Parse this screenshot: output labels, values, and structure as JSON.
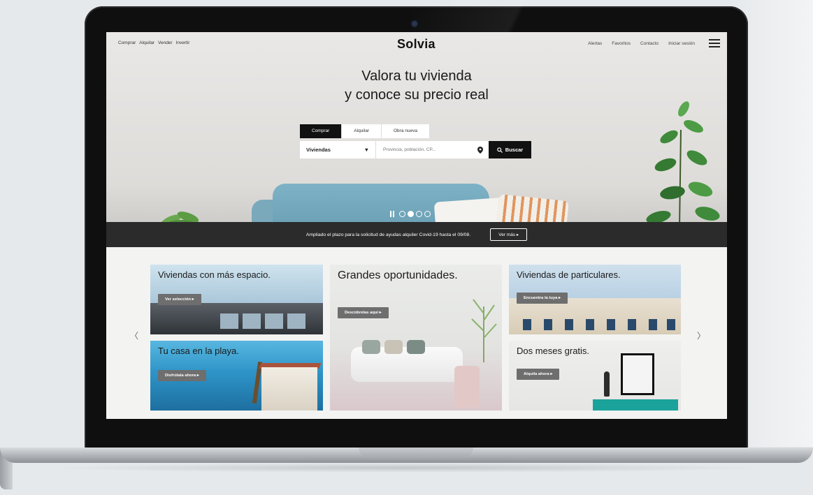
{
  "nav": {
    "left_items": [
      "Comprar",
      "Alquilar",
      "Vender",
      "Invertir"
    ],
    "logo": "Solvia",
    "right_items": [
      "Alertas",
      "Favoritos",
      "Contacto",
      "Iniciar sesión"
    ]
  },
  "hero": {
    "title_line1": "Valora tu vivienda",
    "title_line2": "y conoce su precio real"
  },
  "search": {
    "tabs": [
      "Comprar",
      "Alquilar",
      "Obra nueva"
    ],
    "active_tab": "Comprar",
    "type_value": "Viviendas",
    "location_placeholder": "Provincia, población, CP...",
    "button_label": "Buscar"
  },
  "carousel": {
    "slides": 4,
    "active": 2
  },
  "banner": {
    "text": "Ampliado el plazo para la solicitud de ayudas alquiler Covid-19 hasta el 09/08.",
    "button_label": "Ver más"
  },
  "cards": [
    {
      "title": "Viviendas con más espacio.",
      "button": "Ver selección"
    },
    {
      "title": "Tu casa en la playa.",
      "button": "Disfrútala ahora"
    },
    {
      "title": "Grandes oportunidades.",
      "button": "Descúbrelas aquí"
    },
    {
      "title": "Viviendas de particulares.",
      "button": "Encuentra la tuya"
    },
    {
      "title": "Dos meses gratis.",
      "button": "Alquila ahora"
    }
  ],
  "colors": {
    "accent_dark": "#111111",
    "banner_bg": "#2b2b2b",
    "card_button": "#6e6e6e"
  }
}
